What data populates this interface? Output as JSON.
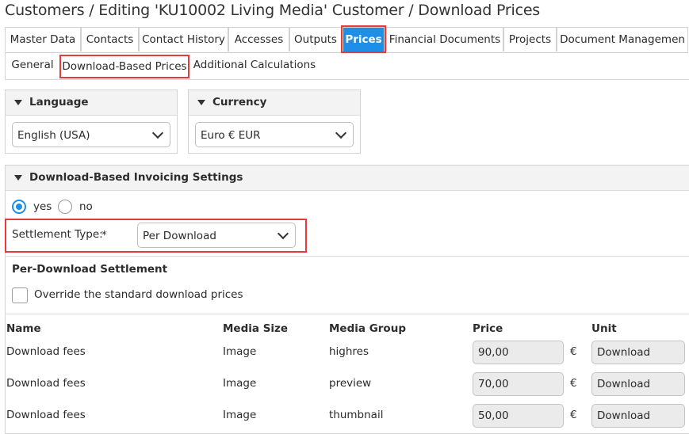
{
  "title": "Customers / Editing 'KU10002 Living Media' Customer / Download Prices",
  "tabs": [
    "Master Data",
    "Contacts",
    "Contact History",
    "Accesses",
    "Outputs",
    "Prices",
    "Financial Documents",
    "Projects",
    "Document Managemen"
  ],
  "active_tab": "Prices",
  "subtabs": [
    "General",
    "Download-Based Prices",
    "Additional Calculations"
  ],
  "active_subtab": "Download-Based Prices",
  "language": {
    "title": "Language",
    "value": "English (USA)"
  },
  "currency": {
    "title": "Currency",
    "value": "Euro € EUR"
  },
  "invoicing": {
    "title": "Download-Based Invoicing Settings",
    "yes_label": "yes",
    "no_label": "no",
    "selected": "yes",
    "settlement_label": "Settlement Type:",
    "required_mark": "*",
    "settlement_value": "Per Download"
  },
  "per_download": {
    "heading": "Per-Download Settlement",
    "override_label": "Override the standard download prices",
    "override_checked": false
  },
  "table": {
    "headers": [
      "Name",
      "Media Size",
      "Media Group",
      "Price",
      "Unit"
    ],
    "currency_symbol": "€",
    "rows": [
      {
        "name": "Download fees",
        "size": "Image",
        "group": "highres",
        "price": "90,00",
        "unit": "Download"
      },
      {
        "name": "Download fees",
        "size": "Image",
        "group": "preview",
        "price": "70,00",
        "unit": "Download"
      },
      {
        "name": "Download fees",
        "size": "Image",
        "group": "thumbnail",
        "price": "50,00",
        "unit": "Download"
      }
    ]
  },
  "colors": {
    "accent": "#1e8ee6",
    "highlight": "#e8393e"
  }
}
